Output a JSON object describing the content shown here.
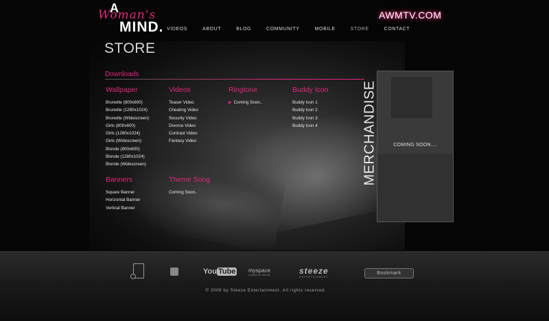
{
  "header": {
    "logo": {
      "a": "A",
      "woman": "Woman's",
      "mind": "MIND."
    },
    "site_link": "AWMTV.COM",
    "nav": [
      "VIDEOS",
      "ABOUT",
      "BLOG",
      "COMMUNITY",
      "MOBILE",
      "STORE",
      "CONTACT"
    ],
    "active_nav": "STORE"
  },
  "page_title": "STORE",
  "downloads": {
    "heading": "Downloads",
    "wallpaper": {
      "title": "Wallpaper",
      "items": [
        "Brunette (800x600)",
        "Brunette (1280x1024)",
        "Brunette (Widescreen)",
        "Girls (800x600)",
        "Girls (1280x1024)",
        "Girls (Widescreen)",
        "Blonde (800x600)",
        "Blonde (1280x1024)",
        "Blonde (Widescreen)"
      ]
    },
    "videos": {
      "title": "Videos",
      "items": [
        "Teaser Video",
        "Cheating Video",
        "Security Video",
        "Divorce Video",
        "Contrast Video",
        "Fantasy Video"
      ]
    },
    "ringtone": {
      "title": "Ringtone",
      "items": [
        "Coming Soon.."
      ]
    },
    "buddy_icon": {
      "title": "Buddy Icon",
      "items": [
        "Buddy Icon 1",
        "Buddy Icon 2",
        "Buddy Icon 3",
        "Buddy Icon 4"
      ]
    },
    "banners": {
      "title": "Banners",
      "items": [
        "Square Banner",
        "Horizontal Banner",
        "Vertical Banner"
      ]
    },
    "theme_song": {
      "title": "Theme Song",
      "items": [
        "Coming Soon.."
      ]
    }
  },
  "merchandise": {
    "label": "MERCHANDISE",
    "status": "COMING SOON....",
    "accent_color": "#e0297a"
  },
  "footer": {
    "youtube": {
      "you": "You",
      "tube": "Tube"
    },
    "myspace": {
      "name": "myspace",
      "tagline": "a place for friends"
    },
    "steeze": {
      "name": "steeze",
      "tagline": "ENTERTAINMENT"
    },
    "bookmark_label": "Bookmark",
    "copyright": "© 2009 by Steeze Entertainment. All rights reserved."
  }
}
